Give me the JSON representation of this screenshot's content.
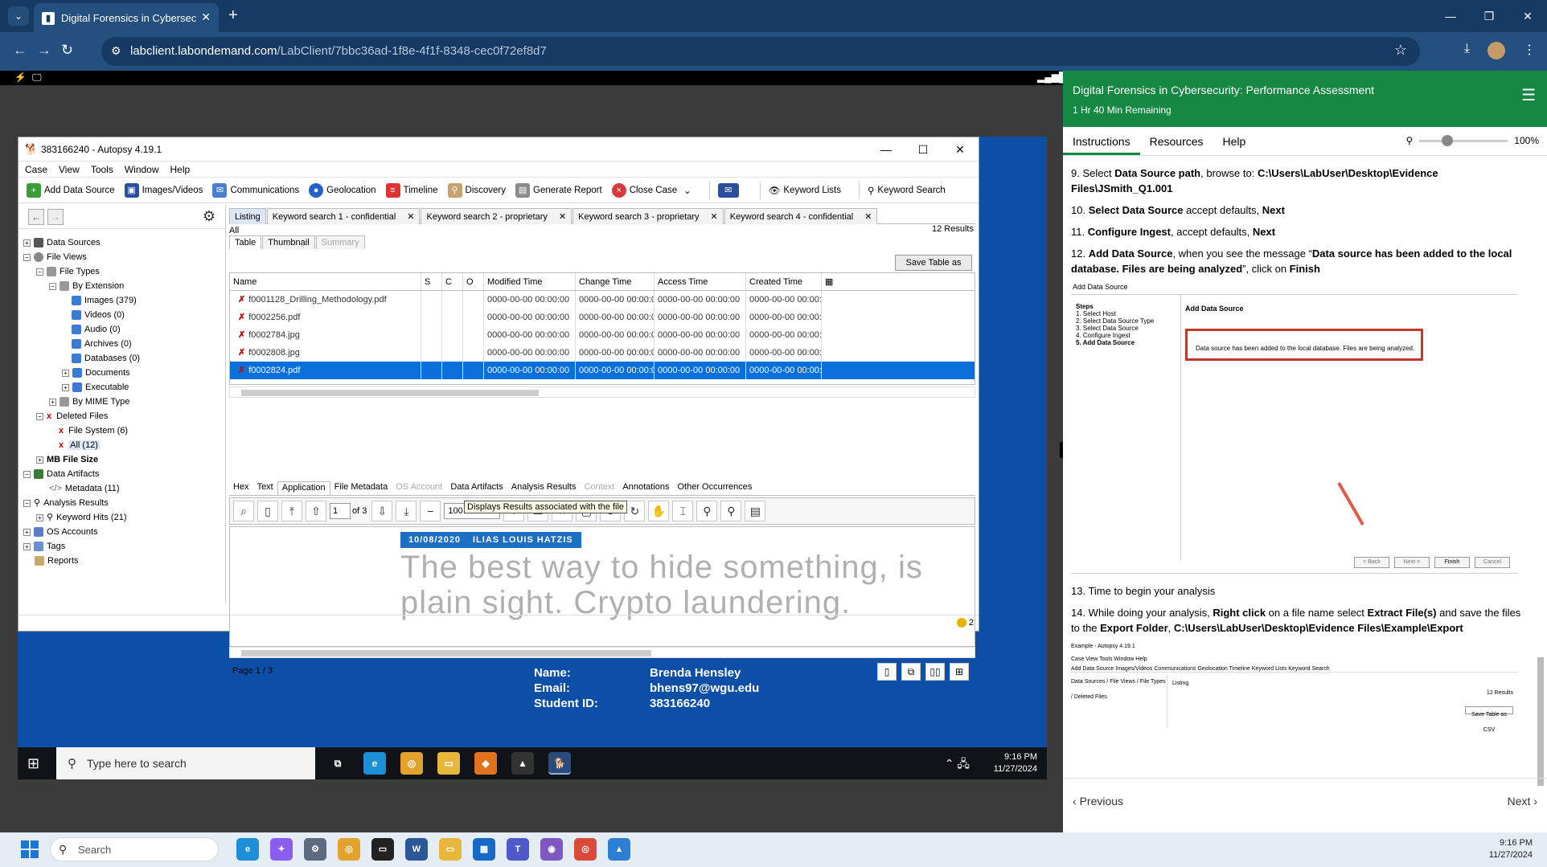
{
  "browser": {
    "tab_title": "Digital Forensics in Cybersecurity",
    "url_host": "labclient.labondemand.com",
    "url_path": "/LabClient/7bbc36ad-1f8e-4f1f-8348-cec0f72ef8d7"
  },
  "autopsy": {
    "window_title": "383166240 - Autopsy 4.19.1",
    "menu": [
      "Case",
      "View",
      "Tools",
      "Window",
      "Help"
    ],
    "toolbar": {
      "add_data_source": "Add Data Source",
      "images_videos": "Images/Videos",
      "communications": "Communications",
      "geolocation": "Geolocation",
      "timeline": "Timeline",
      "discovery": "Discovery",
      "generate_report": "Generate Report",
      "close_case": "Close Case",
      "keyword_lists": "Keyword Lists",
      "keyword_search": "Keyword Search"
    },
    "tree": {
      "data_sources": "Data Sources",
      "file_views": "File Views",
      "file_types": "File Types",
      "by_extension": "By Extension",
      "images": "Images (379)",
      "videos": "Videos (0)",
      "audio": "Audio (0)",
      "archives": "Archives (0)",
      "databases": "Databases (0)",
      "documents": "Documents",
      "executable": "Executable",
      "by_mime_type": "By MIME Type",
      "deleted_files": "Deleted Files",
      "file_system": "File System (6)",
      "all": "All (12)",
      "mb_file_size": "MB File Size",
      "data_artifacts": "Data Artifacts",
      "metadata": "Metadata (11)",
      "analysis_results": "Analysis Results",
      "keyword_hits": "Keyword Hits (21)",
      "os_accounts": "OS Accounts",
      "tags": "Tags",
      "reports": "Reports"
    },
    "result_tabs": [
      "Listing",
      "Keyword search 1 - confidential",
      "Keyword search 2 - proprietary",
      "Keyword search 3 - proprietary",
      "Keyword search 4 - confidential"
    ],
    "all_label": "All",
    "results_count": "12  Results",
    "sub_tabs": [
      "Table",
      "Thumbnail",
      "Summary"
    ],
    "save_csv": "Save Table as CSV",
    "columns": [
      "Name",
      "S",
      "C",
      "O",
      "Modified Time",
      "Change Time",
      "Access Time",
      "Created Time"
    ],
    "rows": [
      {
        "name": "f0001128_Drilling_Methodology.pdf",
        "mod": "0000-00-00 00:00:00",
        "chg": "0000-00-00 00:00:00",
        "acc": "0000-00-00 00:00:00",
        "cre": "0000-00-00 00:00:00"
      },
      {
        "name": "f0002256.pdf",
        "mod": "0000-00-00 00:00:00",
        "chg": "0000-00-00 00:00:00",
        "acc": "0000-00-00 00:00:00",
        "cre": "0000-00-00 00:00:00"
      },
      {
        "name": "f0002784.jpg",
        "mod": "0000-00-00 00:00:00",
        "chg": "0000-00-00 00:00:00",
        "acc": "0000-00-00 00:00:00",
        "cre": "0000-00-00 00:00:00"
      },
      {
        "name": "f0002808.jpg",
        "mod": "0000-00-00 00:00:00",
        "chg": "0000-00-00 00:00:00",
        "acc": "0000-00-00 00:00:00",
        "cre": "0000-00-00 00:00:00"
      },
      {
        "name": "f0002824.pdf",
        "mod": "0000-00-00 00:00:00",
        "chg": "0000-00-00 00:00:00",
        "acc": "0000-00-00 00:00:00",
        "cre": "0000-00-00 00:00:00"
      }
    ],
    "viewer_tabs": [
      "Hex",
      "Text",
      "Application",
      "File Metadata",
      "OS Account",
      "Data Artifacts",
      "Analysis Results",
      "Context",
      "Annotations",
      "Other Occurrences"
    ],
    "page_input": "1",
    "page_of": "of 3",
    "zoom": "100 %",
    "tooltip": "Displays Results associated with the file",
    "pdf_tag_date": "10/08/2020",
    "pdf_tag_name": "ILIAS LOUIS HATZIS",
    "pdf_line1": "The best way to hide something, is",
    "pdf_line2": "plain sight. Crypto laundering.",
    "page_label": "Page 1 / 3",
    "notifications": "2"
  },
  "student": {
    "name_label": "Name:",
    "name": "Brenda Hensley",
    "email_label": "Email:",
    "email": "bhens97@wgu.edu",
    "id_label": "Student ID:",
    "id": "383166240"
  },
  "vm_taskbar": {
    "search": "Type here to search",
    "time": "9:16 PM",
    "date": "11/27/2024"
  },
  "panel": {
    "title": "Digital Forensics in Cybersecurity: Performance Assessment",
    "remaining": "1 Hr 40 Min Remaining",
    "tabs": [
      "Instructions",
      "Resources",
      "Help"
    ],
    "zoom": "100%",
    "step9_a": "9. Select ",
    "step9_b": "Data Source path",
    "step9_c": ", browse to: ",
    "step9_d": "C:\\Users\\LabUser\\Desktop\\Evidence Files\\JSmith_Q1.001",
    "step10_a": "10. ",
    "step10_b": "Select Data Source",
    "step10_c": " accept defaults, ",
    "step10_d": "Next",
    "step11_a": "11. ",
    "step11_b": "Configure Ingest",
    "step11_c": ", accept defaults, ",
    "step11_d": "Next",
    "step12_a": "12. ",
    "step12_b": "Add Data Source",
    "step12_c": ", when you see the message “",
    "step12_d": "Data source has been added to the local database. Files are being analyzed",
    "step12_e": "”, click on ",
    "step12_f": "Finish",
    "shot1_caption": "Add Data Source",
    "shot1_steps_title": "Steps",
    "shot1_steps": [
      "1.  Select Host",
      "2.  Select Data Source Type",
      "3.  Select Data Source",
      "4.  Configure Ingest",
      "5.  Add Data Source"
    ],
    "shot1_header": "Add Data Source",
    "shot1_msg": "Data source has been added to the local database. Files are being analyzed.",
    "shot1_buttons": [
      "< Back",
      "Next >",
      "Finish",
      "Cancel"
    ],
    "step13": "13. Time to begin your analysis",
    "step14_a": "14. While doing your analysis, ",
    "step14_b": "Right click",
    "step14_c": " on a file name select ",
    "step14_d": "Extract File(s)",
    "step14_e": " and save the files to the ",
    "step14_f": "Export Folder",
    "step14_g": ", ",
    "step14_h": "C:\\Users\\LabUser\\Desktop\\Evidence Files\\Example\\Export",
    "shot2_title": "Example - Autopsy 4.19.1",
    "shot2_menu": "Case  View  Tools  Window  Help",
    "shot2_tools": "Add Data Source   Images/Videos   Communications   Geolocation   Timeline        Keyword Lists        Keyword Search",
    "shot2_tree": "Data Sources / File Views / File Types / Deleted Files",
    "shot2_listing": "Listing",
    "shot2_results": "12 Results",
    "shot2_csv": "Save Table as CSV",
    "prev": "Previous",
    "next": "Next"
  },
  "host_taskbar": {
    "search": "Search",
    "time": "9:16 PM",
    "date": "11/27/2024"
  }
}
